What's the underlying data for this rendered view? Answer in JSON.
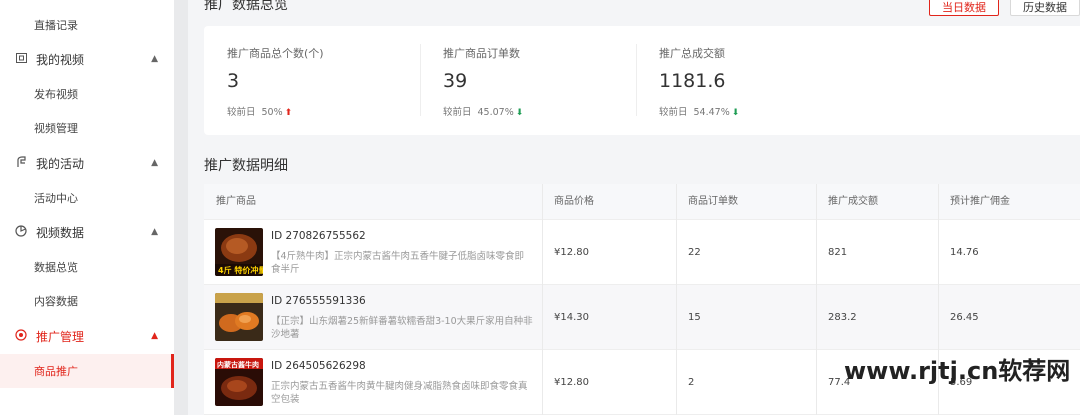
{
  "sidebar": {
    "items": [
      {
        "label": "直播记录",
        "type": "sub"
      },
      {
        "label": "我的视频",
        "type": "group",
        "icon": "video-frame-icon"
      },
      {
        "label": "发布视频",
        "type": "sub"
      },
      {
        "label": "视频管理",
        "type": "sub"
      },
      {
        "label": "我的活动",
        "type": "group",
        "icon": "activity-icon"
      },
      {
        "label": "活动中心",
        "type": "sub"
      },
      {
        "label": "视频数据",
        "type": "group",
        "icon": "pie-chart-icon"
      },
      {
        "label": "数据总览",
        "type": "sub"
      },
      {
        "label": "内容数据",
        "type": "sub"
      },
      {
        "label": "推广管理",
        "type": "group",
        "icon": "target-icon",
        "active": true
      },
      {
        "label": "商品推广",
        "type": "sub",
        "active": true
      }
    ]
  },
  "overview": {
    "title": "推广数据总览",
    "btn_today": "当日数据",
    "btn_history": "历史数据",
    "compare_label": "较前日",
    "stats": [
      {
        "label": "推广商品总个数(个)",
        "value": "3",
        "pct": "50%",
        "trend": "up"
      },
      {
        "label": "推广商品订单数",
        "value": "39",
        "pct": "45.07%",
        "trend": "down"
      },
      {
        "label": "推广总成交额",
        "value": "1181.6",
        "pct": "54.47%",
        "trend": "down"
      }
    ]
  },
  "detail": {
    "title": "推广数据明细",
    "columns": [
      "推广商品",
      "商品价格",
      "商品订单数",
      "推广成交额",
      "预计推广佣金"
    ],
    "rows": [
      {
        "id": "ID 270826755562",
        "name": "【4斤熟牛肉】正宗内蒙古酱牛肉五香牛腱子低脂卤味零食即食半斤",
        "price": "¥12.80",
        "orders": "22",
        "gmv": "821",
        "commission": "14.76",
        "thumb_text": "4斤 特价冲量"
      },
      {
        "id": "ID 276555591336",
        "name": "【正宗】山东烟薯25新鲜番薯软糯香甜3-10大果斤家用自种非沙地薯",
        "price": "¥14.30",
        "orders": "15",
        "gmv": "283.2",
        "commission": "26.45",
        "thumb_text": ""
      },
      {
        "id": "ID 264505626298",
        "name": "正宗内蒙古五香酱牛肉黄牛腱肉健身减脂熟食卤味即食零食真空包装",
        "price": "¥12.80",
        "orders": "2",
        "gmv": "77.4",
        "commission": "5.69",
        "thumb_text": "内蒙古酱牛肉"
      }
    ]
  },
  "watermark": "www.rjtj.cn软荐网",
  "colors": {
    "accent": "#e1251b",
    "up": "#e1251b",
    "down": "#1f9d55"
  }
}
